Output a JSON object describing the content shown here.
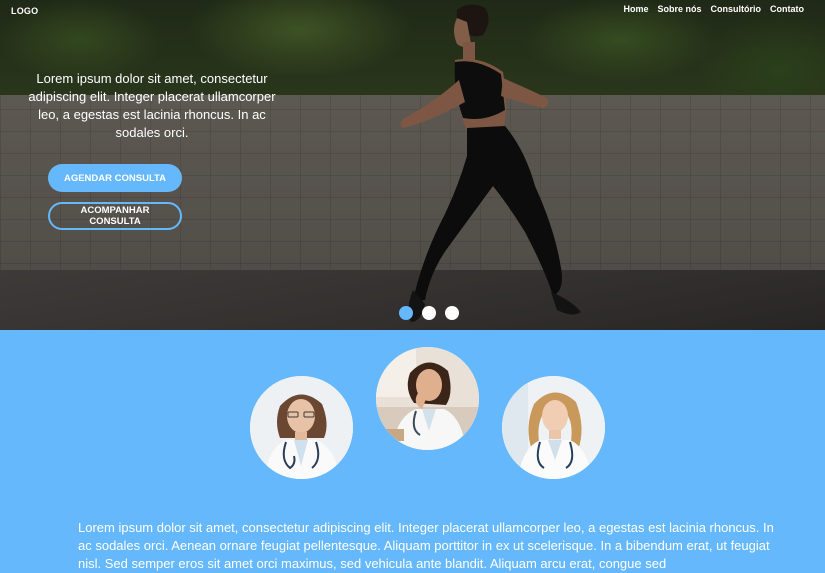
{
  "header": {
    "logo": "LOGO",
    "nav": [
      "Home",
      "Sobre nós",
      "Consultório",
      "Contato"
    ]
  },
  "hero": {
    "text": "Lorem ipsum dolor sit amet, consectetur adipiscing elit. Integer placerat ullamcorper leo, a egestas est lacinia rhoncus. In ac sodales orci.",
    "primary_button": "AGENDAR CONSULTA",
    "secondary_button": "ACOMPANHAR CONSULTA",
    "slides": 3,
    "active_slide": 1
  },
  "team": {
    "text": "Lorem ipsum dolor sit amet, consectetur adipiscing elit. Integer placerat ullamcorper leo, a egestas est lacinia rhoncus. In ac sodales orci. Aenean ornare feugiat pellentesque. Aliquam porttitor in ex ut scelerisque. In a bibendum erat, ut feugiat nisl. Sed semper eros sit amet orci maximus, sed vehicula ante blandit. Aliquam arcu erat, congue sed"
  },
  "colors": {
    "accent": "#64b8fb",
    "text_light": "#ffffff"
  },
  "icons": [
    "doctor-photo",
    "slider-dot"
  ]
}
